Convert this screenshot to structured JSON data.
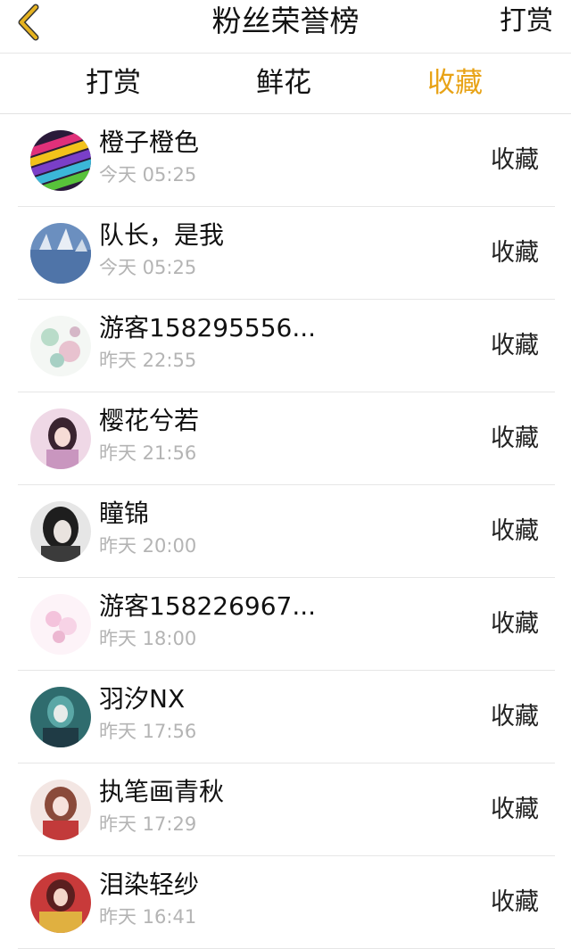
{
  "header": {
    "title": "粉丝荣誉榜",
    "action_label": "打赏",
    "back_icon": "chevron-left-icon",
    "back_icon_color": "#E6B320"
  },
  "tabs": [
    {
      "label": "打赏",
      "active": false
    },
    {
      "label": "鲜花",
      "active": false
    },
    {
      "label": "收藏",
      "active": true
    }
  ],
  "colors": {
    "accent": "#E8A317",
    "text": "#111111",
    "subtext": "#B4B4B4"
  },
  "fans": [
    {
      "name": "橙子橙色",
      "time": "今天 05:25",
      "action": "收藏"
    },
    {
      "name": "队长，是我",
      "time": "今天 05:25",
      "action": "收藏"
    },
    {
      "name": "游客158295556...",
      "time": "昨天 22:55",
      "action": "收藏"
    },
    {
      "name": "樱花兮若",
      "time": "昨天 21:56",
      "action": "收藏"
    },
    {
      "name": "瞳锦",
      "time": "昨天 20:00",
      "action": "收藏"
    },
    {
      "name": "游客158226967...",
      "time": "昨天 18:00",
      "action": "收藏"
    },
    {
      "name": "羽汐NX",
      "time": "昨天 17:56",
      "action": "收藏"
    },
    {
      "name": "执笔画青秋",
      "time": "昨天 17:29",
      "action": "收藏"
    },
    {
      "name": "泪染轻纱",
      "time": "昨天 16:41",
      "action": "收藏"
    }
  ]
}
